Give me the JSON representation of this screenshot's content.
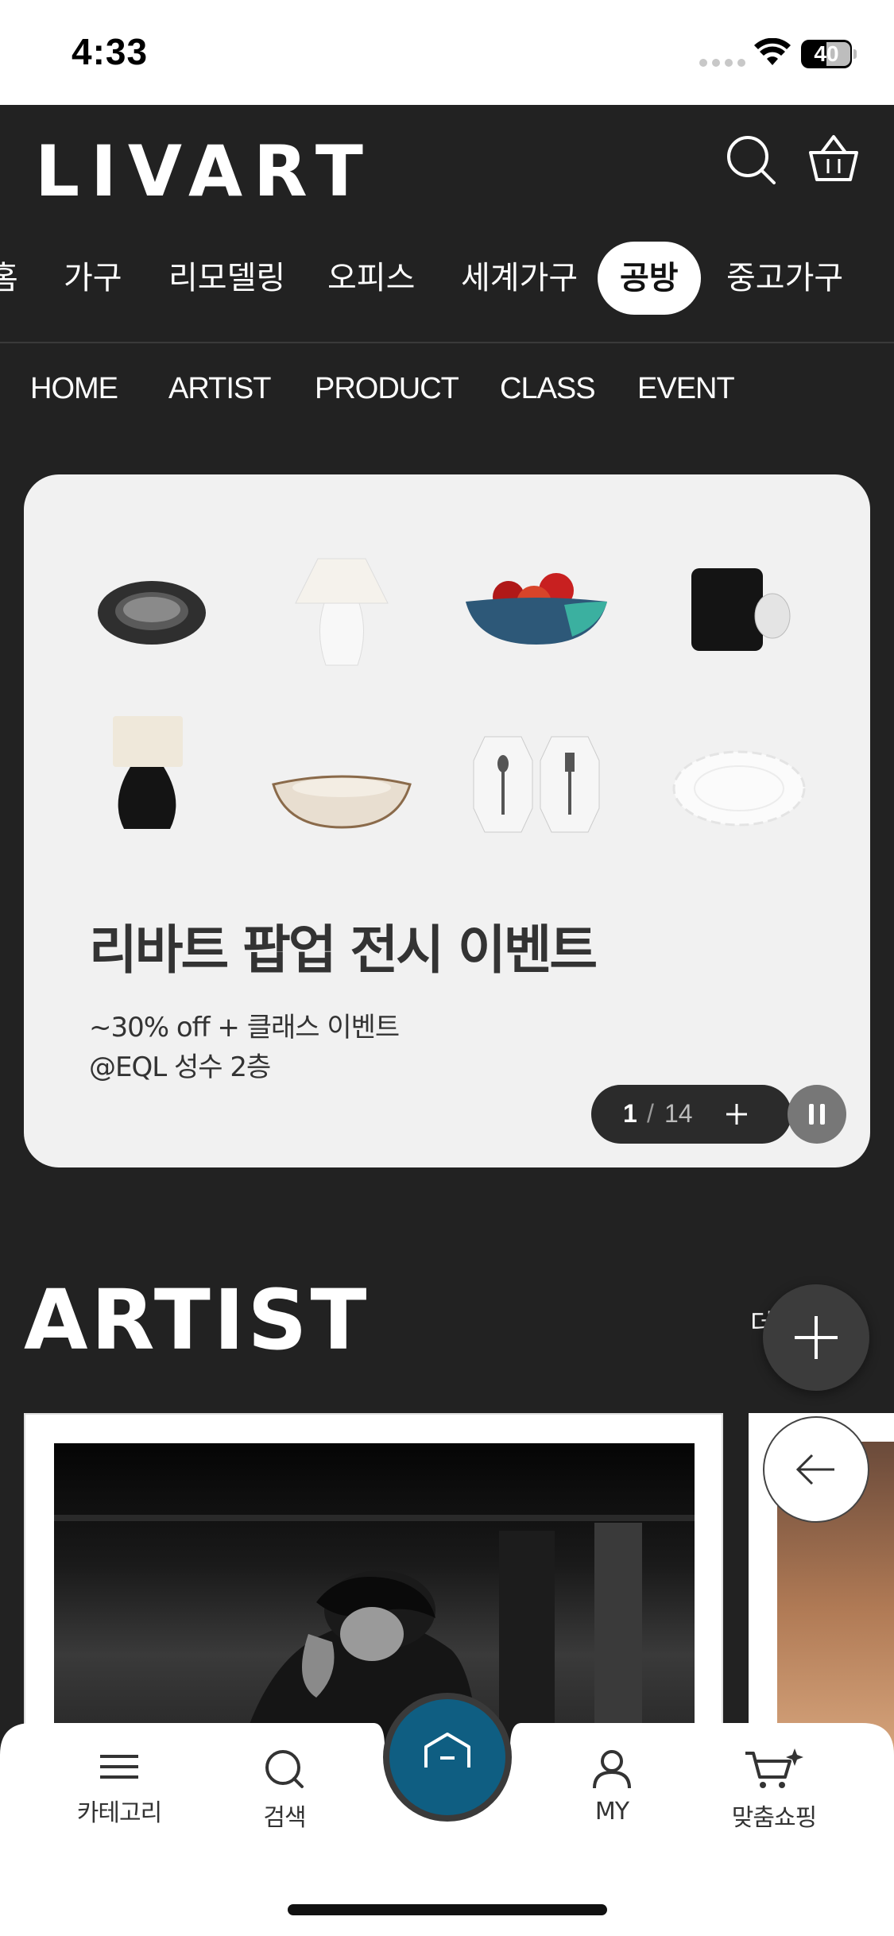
{
  "status_bar": {
    "time": "4:33",
    "battery": "40"
  },
  "header": {
    "logo": "LIVART",
    "search_icon": "search-icon",
    "cart_icon": "basket-icon"
  },
  "categories": {
    "items": [
      {
        "label": "홈"
      },
      {
        "label": "가구"
      },
      {
        "label": "리모델링"
      },
      {
        "label": "오피스"
      },
      {
        "label": "세계가구"
      },
      {
        "label": "공방"
      },
      {
        "label": "중고가구"
      }
    ],
    "active": "공방"
  },
  "sub_nav": {
    "items": [
      "HOME",
      "ARTIST",
      "PRODUCT",
      "CLASS",
      "EVENT"
    ]
  },
  "banner": {
    "title": "리바트 팝업 전시 이벤트",
    "subtitle_line1": "~30% off + 클래스 이벤트",
    "subtitle_line2": "@EQL 성수 2층",
    "pager_current": "1",
    "pager_separator": "/",
    "pager_total": "14",
    "products": [
      "black-ceramic-plate",
      "white-table-lamp",
      "fruit-bowl",
      "black-mug",
      "black-lamp",
      "ceramic-bowl",
      "cutlery-trays",
      "white-scalloped-plate"
    ]
  },
  "artist": {
    "title": "ARTIST",
    "more_label": "더"
  },
  "tabbar": {
    "items": [
      {
        "label": "카테고리",
        "icon": "menu-icon"
      },
      {
        "label": "검색",
        "icon": "search-icon"
      },
      {
        "label": "",
        "icon": "home-icon"
      },
      {
        "label": "MY",
        "icon": "person-icon"
      },
      {
        "label": "맞춤쇼핑",
        "icon": "cart-sparkle-icon"
      }
    ]
  },
  "colors": {
    "background": "#222222",
    "home_button": "#0f5e82",
    "card": "#f1f1f1"
  }
}
